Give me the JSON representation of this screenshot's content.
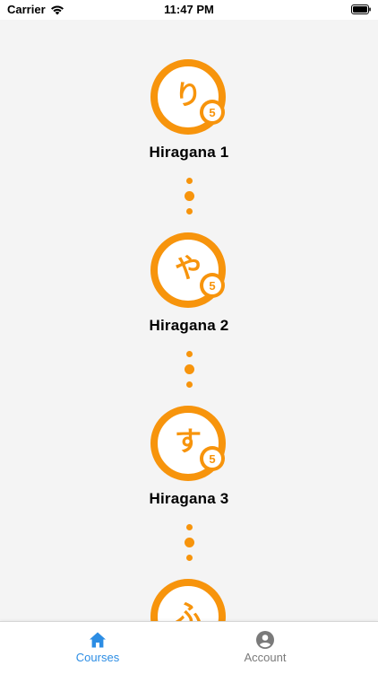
{
  "status_bar": {
    "carrier": "Carrier",
    "time": "11:47 PM"
  },
  "courses": [
    {
      "kana": "り",
      "title": "Hiragana 1",
      "lesson_count": "5"
    },
    {
      "kana": "や",
      "title": "Hiragana 2",
      "lesson_count": "5"
    },
    {
      "kana": "す",
      "title": "Hiragana 3",
      "lesson_count": "5"
    },
    {
      "kana": "ふ",
      "title": "",
      "lesson_count": ""
    }
  ],
  "tab_bar": {
    "courses_label": "Courses",
    "account_label": "Account"
  },
  "colors": {
    "accent": "#f7940c",
    "active_tab": "#2c8de4",
    "inactive_tab": "#7a7a7a"
  }
}
